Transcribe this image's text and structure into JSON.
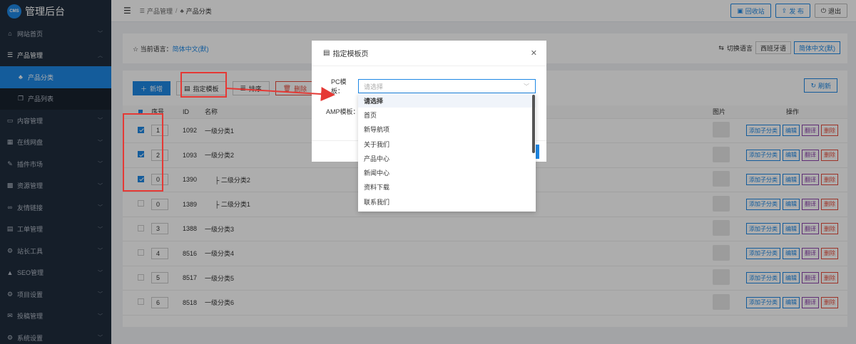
{
  "app": {
    "logo_badge": "CMS",
    "title": "管理后台"
  },
  "sidebar": {
    "items": [
      {
        "label": "网站首页",
        "icon": "home-icon"
      },
      {
        "label": "产品管理",
        "icon": "menu-icon",
        "open": true
      },
      {
        "label": "产品分类",
        "icon": "sitemap-icon",
        "sub": true,
        "active": true
      },
      {
        "label": "产品列表",
        "icon": "copy-icon",
        "sub": true
      },
      {
        "label": "内容管理",
        "icon": "card-icon"
      },
      {
        "label": "在线网盘",
        "icon": "grid-icon"
      },
      {
        "label": "插件市场",
        "icon": "pin-icon"
      },
      {
        "label": "资源管理",
        "icon": "apps-icon"
      },
      {
        "label": "友情链接",
        "icon": "link-icon"
      },
      {
        "label": "工单管理",
        "icon": "doc-icon"
      },
      {
        "label": "站长工具",
        "icon": "gears-icon"
      },
      {
        "label": "SEO管理",
        "icon": "warning-icon"
      },
      {
        "label": "项目设置",
        "icon": "gear-icon"
      },
      {
        "label": "投稿管理",
        "icon": "mail-icon"
      },
      {
        "label": "系统设置",
        "icon": "gear-icon"
      }
    ]
  },
  "breadcrumb": {
    "parent": "产品管理",
    "sep": "/",
    "current": "产品分类"
  },
  "top_actions": {
    "recycle": "回收站",
    "publish": "发 布",
    "logout": "退出"
  },
  "lang": {
    "label": "☆ 当前语言：",
    "current": "简体中文(默)",
    "switch_label": "切换语言",
    "options": [
      "西班牙语",
      "简体中文(默)"
    ]
  },
  "toolbar": {
    "add": "新增",
    "template": "指定模板",
    "sort": "排序",
    "delete": "删除",
    "refresh": "刷新"
  },
  "table": {
    "headers": {
      "seq": "序号",
      "id": "ID",
      "name": "名称",
      "image": "图片",
      "ops": "操作"
    },
    "ops": {
      "add_child": "添加子分类",
      "edit": "编辑",
      "translate": "翻译",
      "delete": "删除"
    },
    "rows": [
      {
        "checked": true,
        "seq": "1",
        "id": "1092",
        "name": "一级分类1",
        "child": false
      },
      {
        "checked": true,
        "seq": "2",
        "id": "1093",
        "name": "一级分类2",
        "child": false
      },
      {
        "checked": true,
        "seq": "0",
        "id": "1390",
        "name": "├ 二级分类2",
        "child": true
      },
      {
        "checked": false,
        "seq": "0",
        "id": "1389",
        "name": "├ 二级分类1",
        "child": true
      },
      {
        "checked": false,
        "seq": "3",
        "id": "1388",
        "name": "一级分类3",
        "child": false
      },
      {
        "checked": false,
        "seq": "4",
        "id": "8516",
        "name": "一级分类4",
        "child": false
      },
      {
        "checked": false,
        "seq": "5",
        "id": "8517",
        "name": "一级分类5",
        "child": false
      },
      {
        "checked": false,
        "seq": "6",
        "id": "8518",
        "name": "一级分类6",
        "child": false
      }
    ]
  },
  "modal": {
    "title": "指定模板页",
    "pc_label": "PC模板：",
    "amp_label": "AMP模板：",
    "placeholder": "请选择",
    "options": [
      "请选择",
      "首页",
      "新导航项",
      "关于我们",
      "产品中心",
      "新闻中心",
      "资料下载",
      "联系我们"
    ]
  },
  "colors": {
    "sidebar": "#1f2d3d",
    "accent": "#1e88e5",
    "danger": "#e74c3c",
    "annotation": "#e53935"
  }
}
